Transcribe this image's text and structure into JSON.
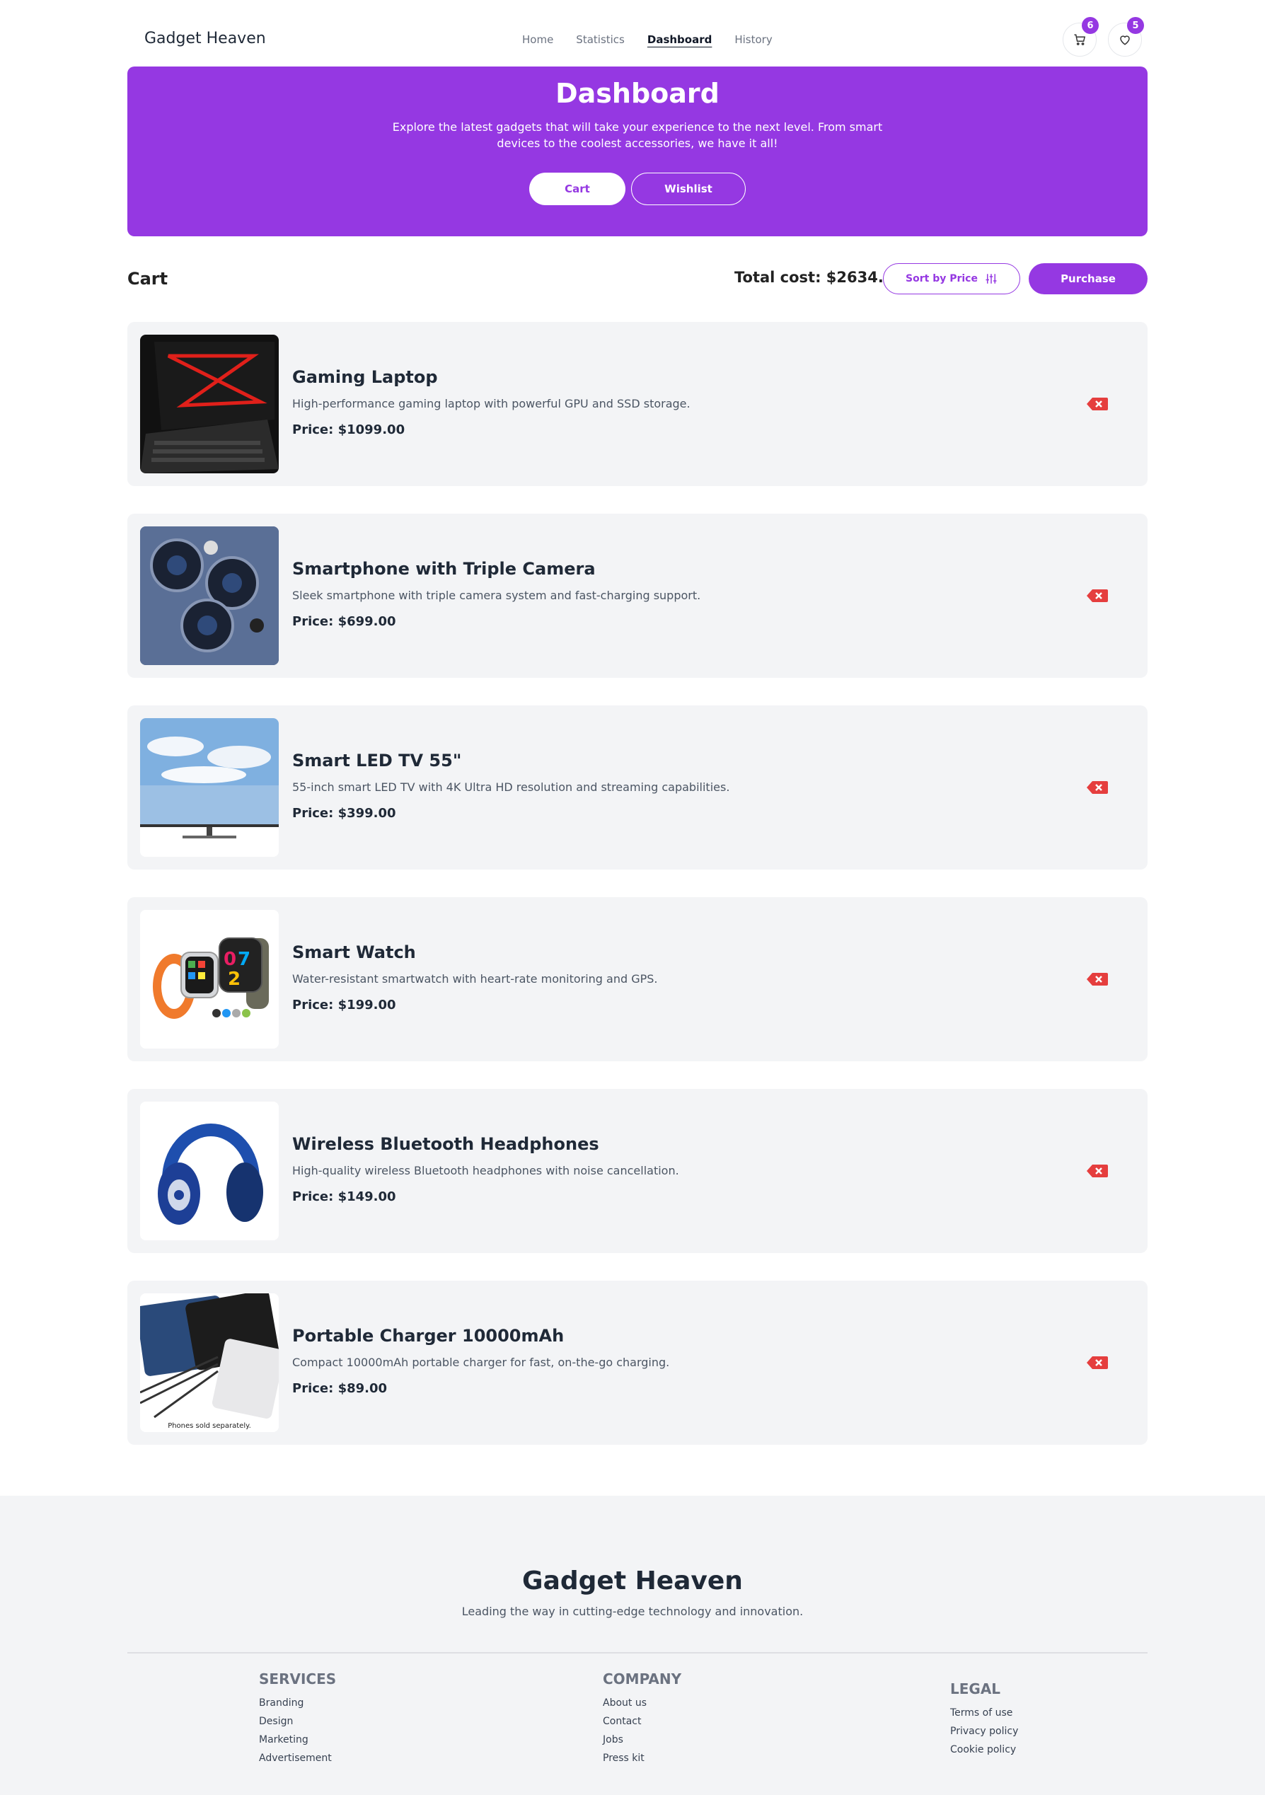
{
  "header": {
    "brand": "Gadget Heaven",
    "nav": [
      "Home",
      "Statistics",
      "Dashboard",
      "History"
    ],
    "active_nav": "Dashboard",
    "cart_count": "6",
    "wishlist_count": "5"
  },
  "hero": {
    "title": "Dashboard",
    "description": "Explore the latest gadgets that will take your experience to the next level. From smart devices to the coolest accessories, we have it all!",
    "tab_cart": "Cart",
    "tab_wishlist": "Wishlist"
  },
  "cart": {
    "title": "Cart",
    "total": "Total cost: $2634.00",
    "sort_label": "Sort by Price",
    "purchase_label": "Purchase",
    "items": [
      {
        "name": "Gaming Laptop",
        "description": "High-performance gaming laptop with powerful GPU and SSD storage.",
        "price": "Price: $1099.00",
        "image": "gaming-laptop-image"
      },
      {
        "name": "Smartphone with Triple Camera",
        "description": "Sleek smartphone with triple camera system and fast-charging support.",
        "price": "Price: $699.00",
        "image": "smartphone-image"
      },
      {
        "name": "Smart LED TV 55\"",
        "description": "55-inch smart LED TV with 4K Ultra HD resolution and streaming capabilities.",
        "price": "Price: $399.00",
        "image": "led-tv-image"
      },
      {
        "name": "Smart Watch",
        "description": "Water-resistant smartwatch with heart-rate monitoring and GPS.",
        "price": "Price: $199.00",
        "image": "smart-watch-image"
      },
      {
        "name": "Wireless Bluetooth Headphones",
        "description": "High-quality wireless Bluetooth headphones with noise cancellation.",
        "price": "Price: $149.00",
        "image": "headphones-image"
      },
      {
        "name": "Portable Charger 10000mAh",
        "description": "Compact 10000mAh portable charger for fast, on-the-go charging.",
        "price": "Price: $89.00",
        "image": "portable-charger-image",
        "image_caption": "Phones sold separately."
      }
    ]
  },
  "footer": {
    "brand": "Gadget Heaven",
    "tagline": "Leading the way in cutting-edge technology and innovation.",
    "columns": [
      {
        "title": "SERVICES",
        "links": [
          "Branding",
          "Design",
          "Marketing",
          "Advertisement"
        ]
      },
      {
        "title": "COMPANY",
        "links": [
          "About us",
          "Contact",
          "Jobs",
          "Press kit"
        ]
      },
      {
        "title": "LEGAL",
        "links": [
          "Terms of use",
          "Privacy policy",
          "Cookie policy"
        ]
      }
    ]
  },
  "colors": {
    "accent": "#9538e2",
    "card_bg": "#f3f4f6",
    "remove": "#e53e3e"
  }
}
